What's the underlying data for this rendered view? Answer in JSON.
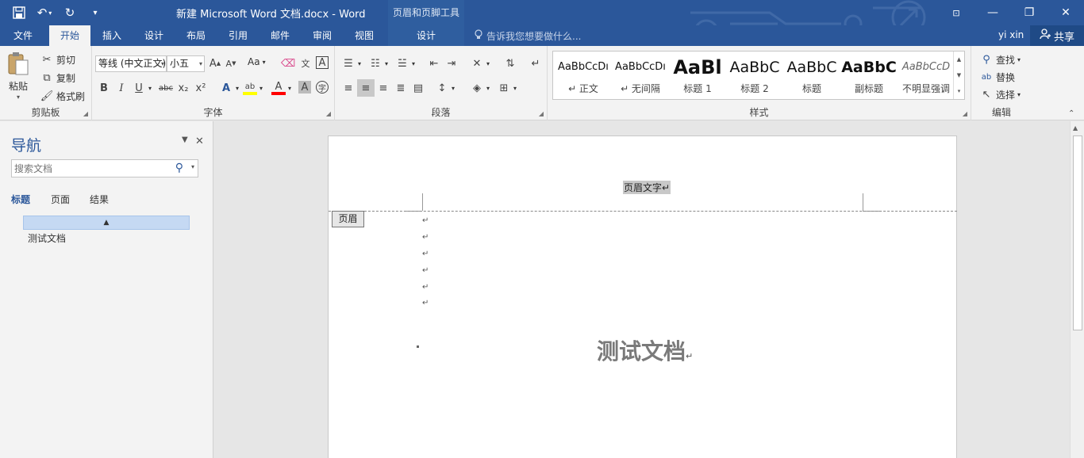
{
  "titlebar": {
    "title": "新建 Microsoft Word 文档.docx - Word",
    "context_group": "页眉和页脚工具"
  },
  "tabs": [
    {
      "label": "文件"
    },
    {
      "label": "开始"
    },
    {
      "label": "插入"
    },
    {
      "label": "设计"
    },
    {
      "label": "布局"
    },
    {
      "label": "引用"
    },
    {
      "label": "邮件"
    },
    {
      "label": "审阅"
    },
    {
      "label": "视图"
    },
    {
      "label": "设计"
    }
  ],
  "tellme": {
    "placeholder": "告诉我您想要做什么..."
  },
  "account": {
    "user": "yi xin",
    "share": "共享"
  },
  "clipboard": {
    "paste": "粘贴",
    "cut": "剪切",
    "copy": "复制",
    "format_painter": "格式刷",
    "label": "剪贴板"
  },
  "font": {
    "font_name": "等线 (中文正文)",
    "font_size": "小五",
    "label": "字体",
    "change_case": "Aa",
    "bold": "B",
    "italic": "I",
    "underline": "U",
    "strikethrough": "abc",
    "subscript": "x₂",
    "superscript": "x²"
  },
  "paragraph": {
    "label": "段落"
  },
  "styles": {
    "label": "样式",
    "items": [
      {
        "sample": "AaBbCcDı",
        "name": "↵ 正文"
      },
      {
        "sample": "AaBbCcDı",
        "name": "↵ 无间隔"
      },
      {
        "sample": "AaBl",
        "name": "标题 1"
      },
      {
        "sample": "AaBbC",
        "name": "标题 2"
      },
      {
        "sample": "AaBbC",
        "name": "标题"
      },
      {
        "sample": "AaBbC",
        "name": "副标题"
      },
      {
        "sample": "AaBbCcD",
        "name": "不明显强调"
      }
    ]
  },
  "editing": {
    "find": "查找",
    "replace": "替换",
    "select": "选择",
    "label": "编辑"
  },
  "nav": {
    "title": "导航",
    "search_placeholder": "搜索文档",
    "tabs": [
      {
        "label": "标题"
      },
      {
        "label": "页面"
      },
      {
        "label": "结果"
      }
    ],
    "heading_bar_glyph": "▲",
    "headings": [
      {
        "text": "测试文档"
      }
    ]
  },
  "document": {
    "header_text": "页眉文字↵",
    "header_tag": "页眉",
    "paragraph_mark": "↵",
    "title": "测试文档",
    "title_mark": "↵"
  },
  "colors": {
    "accent": "#2b579a",
    "ribbon_bg": "#f3f3f3",
    "highlight": "#ffff00",
    "font_color": "#ff0000"
  }
}
